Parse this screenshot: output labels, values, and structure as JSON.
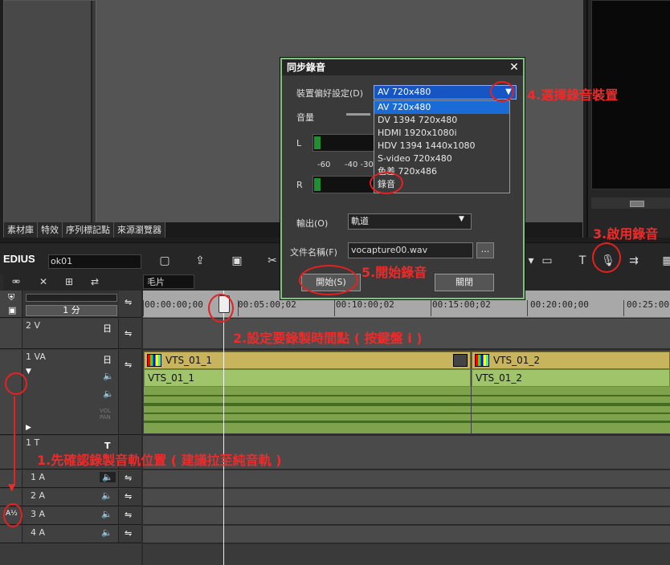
{
  "bin_tabs": [
    "素材庫",
    "特效",
    "序列標記點",
    "來源瀏覽器"
  ],
  "app": {
    "name": "EDIUS",
    "project": "ok01"
  },
  "timeline": {
    "tab": "毛片",
    "zoom": "1 分",
    "ruler": [
      "00:00:00;00",
      "00:05:00;02",
      "00:10:00;02",
      "00:15:00;02",
      "00:20:00;00",
      "00:25:00;02"
    ]
  },
  "tracks": {
    "v2": "2 V",
    "va1": "1 VA",
    "t1": "1 T",
    "a1": "1 A",
    "a2": "2 A",
    "a3": "3 A",
    "a4": "4 A",
    "vol_pan": "VOL\nPAN"
  },
  "clips": {
    "v1": "VTS_01_1",
    "v2": "VTS_01_2",
    "a1": "VTS_01_1",
    "a2": "VTS_01_2"
  },
  "dialog": {
    "title": "同步錄音",
    "device_label": "裝置偏好設定(D)",
    "device_value": "AV 720x480",
    "device_options": [
      "AV 720x480",
      "DV 1394 720x480",
      "HDMI 1920x1080i",
      "HDV 1394 1440x1080",
      "S-video 720x480",
      "色差 720x486",
      "錄音"
    ],
    "volume_label": "音量",
    "left": "L",
    "right": "R",
    "scale_a": "-60",
    "scale_b": "-40 -30",
    "output_label": "輸出(O)",
    "output_value": "軌道",
    "filename_label": "文件名稱(F)",
    "filename_value": "vocapture00.wav",
    "browse": "...",
    "start_button": "開始(S)",
    "close_button": "關閉"
  },
  "annotations": {
    "a1": "1.先確認錄製音軌位置 ( 建議拉至純音軌 )",
    "a2": "2.設定要錄製時間點 ( 按鍵盤 i )",
    "a3": "3.啟用錄音",
    "a4": "4.選擇錄音裝置",
    "a5": "5.開始錄音"
  },
  "colors": {
    "annotation": "#ee2b2b",
    "dialog_border": "#7cc47a",
    "selection": "#1a6bd6",
    "video_clip": "#c8b45c",
    "audio_clip": "#9fc46a"
  }
}
